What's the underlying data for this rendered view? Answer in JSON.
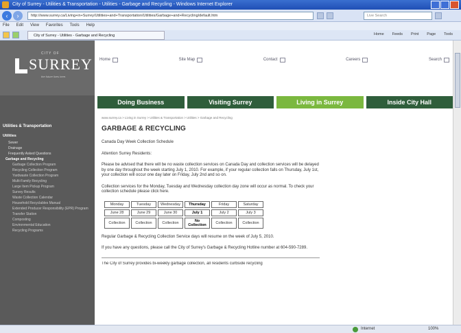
{
  "browser": {
    "title": "City of Surrey - Utilities & Transportation - Utilities - Garbage and Recycling - Windows Internet Explorer",
    "url": "http://www.surrey.ca/Living+in+Surrey/Utilities+and+Transportation/Utilities/Garbage+and+Recycling/default.htm",
    "search_placeholder": "Live Search",
    "menu": [
      "File",
      "Edit",
      "View",
      "Favorites",
      "Tools",
      "Help"
    ],
    "tab_title": "City of Surrey - Utilities - Garbage and Recycling",
    "tools": [
      "Home",
      "Feeds",
      "Print",
      "Page",
      "Tools"
    ],
    "status_zone": "Internet",
    "status_zoom": "100%"
  },
  "site": {
    "logo_city_of": "CITY OF",
    "logo_name": "SURREY",
    "logo_tagline": "the future lives here.",
    "top_links": [
      "Home",
      "Site Map",
      "Contact",
      "Careers",
      "Search"
    ],
    "main_nav": [
      "Doing Business",
      "Visiting Surrey",
      "Living in Surrey",
      "Inside City Hall"
    ]
  },
  "sidebar": {
    "heading": "Utilities & Transportation",
    "subheading": "Utilities",
    "items": [
      "Sewer",
      "Drainage",
      "Frequently Asked Questions",
      "Garbage and Recycling",
      "Garbage Collection Program",
      "Recycling Collection Program",
      "Yardwaste Collection Program",
      "Multi-Family Recycling",
      "Large Item Pickup Program",
      "Survey Results",
      "Waste Collection Calendar",
      "Household Recyclables Manual",
      "Extended Producer Responsibility (EPR) Program",
      "Transfer Station",
      "Composting",
      "Environmental Education",
      "Recycling Programs"
    ]
  },
  "content": {
    "breadcrumb": "www.surrey.ca > Living in Surrey > Utilities & Transportation > Utilities > Garbage and Recycling",
    "title": "GARBAGE & RECYCLING",
    "subtitle": "Canada Day Week Collection Schedule",
    "attention": "Attention Surrey Residents:",
    "para1": "Please be advised that there will be no waste collection services on Canada Day and collection services will be delayed by one day throughout the week starting July 1, 2010. For example, if your regular collection falls on Thursday, July 1st, your collection will occur one day later on Friday, July 2nd and so on.",
    "para2": "Collection services for the Monday, Tuesday and Wednesday collection day zone will occur as normal. To check your collection schedule please click here.",
    "schedule": {
      "days": [
        "Monday",
        "Tuesday",
        "Wednesday",
        "Thursday",
        "Friday",
        "Saturday"
      ],
      "dates": [
        "June 28",
        "June 29",
        "June 30",
        "July 1",
        "July 2",
        "July 3"
      ],
      "status": [
        "Collection",
        "Collection",
        "Collection",
        "No Collection",
        "Collection",
        "Collection"
      ]
    },
    "para3": "Regular Garbage & Recycling Collection Service days will resume on the week of July 5, 2010.",
    "para4": "If you have any questions, please call the City of Surrey's Garbage & Recycling Hotline number at 604-590-7289.",
    "para5": "The City of Surrey provides bi-weekly garbage collection, all residents curbside recycling"
  }
}
